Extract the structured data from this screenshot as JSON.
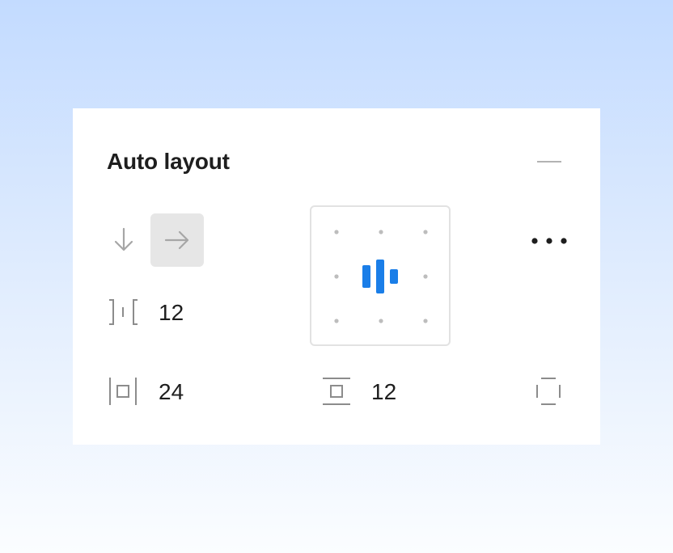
{
  "panel": {
    "title": "Auto layout"
  },
  "direction": {
    "options": [
      "vertical",
      "horizontal"
    ],
    "selected": "horizontal"
  },
  "gap": {
    "value": "12",
    "icon": "item-spacing-icon"
  },
  "padding": {
    "horizontal_value": "24",
    "horizontal_icon": "horizontal-padding-icon",
    "vertical_value": "12",
    "vertical_icon": "vertical-padding-icon"
  },
  "alignment": {
    "selected": "center",
    "icon": "align-center-icon"
  },
  "icons": {
    "collapse": "minus-icon",
    "more": "more-options-icon",
    "clip": "clip-content-icon"
  },
  "colors": {
    "accent": "#1a7ee8",
    "icon_gray": "#8c8c8c",
    "selected_bg": "#e6e6e6",
    "dot": "#bdbdbd"
  }
}
